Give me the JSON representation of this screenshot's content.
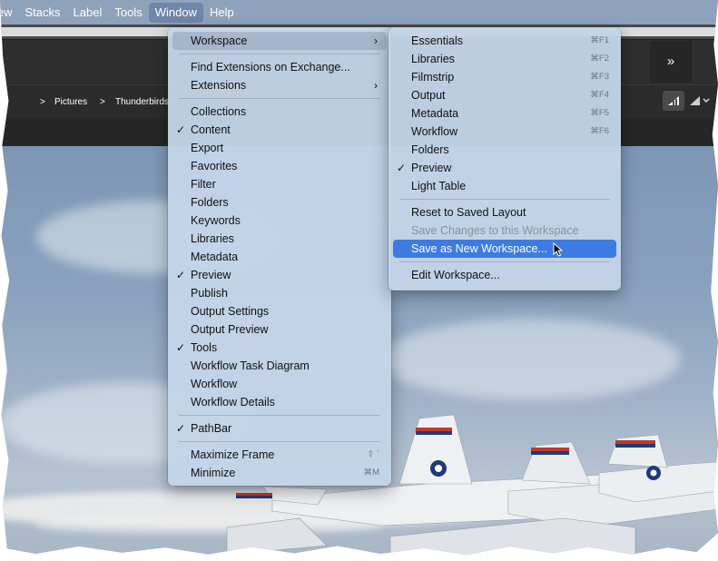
{
  "menubar": {
    "items": [
      "iew",
      "Stacks",
      "Label",
      "Tools",
      "Window",
      "Help"
    ],
    "active_index": 4
  },
  "header": {
    "expand_glyph": "»"
  },
  "pathbar": {
    "sep1": ">",
    "crumb1": "Pictures",
    "sep2": ">",
    "crumb2": "Thunderbirds"
  },
  "window_menu": {
    "sections": [
      [
        {
          "label": "Workspace",
          "submenu": true,
          "highlighted": true
        }
      ],
      [
        {
          "label": "Find Extensions on Exchange..."
        },
        {
          "label": "Extensions",
          "submenu": true
        }
      ],
      [
        {
          "label": "Collections"
        },
        {
          "label": "Content",
          "checked": true
        },
        {
          "label": "Export"
        },
        {
          "label": "Favorites"
        },
        {
          "label": "Filter"
        },
        {
          "label": "Folders"
        },
        {
          "label": "Keywords"
        },
        {
          "label": "Libraries"
        },
        {
          "label": "Metadata"
        },
        {
          "label": "Preview",
          "checked": true
        },
        {
          "label": "Publish"
        },
        {
          "label": "Output Settings"
        },
        {
          "label": "Output Preview"
        },
        {
          "label": "Tools",
          "checked": true
        },
        {
          "label": "Workflow Task Diagram"
        },
        {
          "label": "Workflow"
        },
        {
          "label": "Workflow Details"
        }
      ],
      [
        {
          "label": "PathBar",
          "checked": true
        }
      ],
      [
        {
          "label": "Maximize Frame",
          "shortcut": "⇧ `"
        },
        {
          "label": "Minimize",
          "shortcut": "⌘M"
        }
      ]
    ]
  },
  "workspace_menu": {
    "sections": [
      [
        {
          "label": "Essentials",
          "shortcut": "⌘F1"
        },
        {
          "label": "Libraries",
          "shortcut": "⌘F2"
        },
        {
          "label": "Filmstrip",
          "shortcut": "⌘F3"
        },
        {
          "label": "Output",
          "shortcut": "⌘F4"
        },
        {
          "label": "Metadata",
          "shortcut": "⌘F5"
        },
        {
          "label": "Workflow",
          "shortcut": "⌘F6"
        },
        {
          "label": "Folders"
        },
        {
          "label": "Preview",
          "checked": true
        },
        {
          "label": "Light Table"
        }
      ],
      [
        {
          "label": "Reset to Saved Layout"
        },
        {
          "label": "Save Changes to this Workspace",
          "disabled": true
        },
        {
          "label": "Save as New Workspace...",
          "selected": true
        }
      ],
      [
        {
          "label": "Edit Workspace..."
        }
      ]
    ]
  },
  "glyphs": {
    "check": "✓",
    "submenu_arrow": "›"
  },
  "colors": {
    "selection_blue": "#3d7be0",
    "menu_background": "#c4d4e8",
    "app_dark": "#2e2e2e"
  }
}
